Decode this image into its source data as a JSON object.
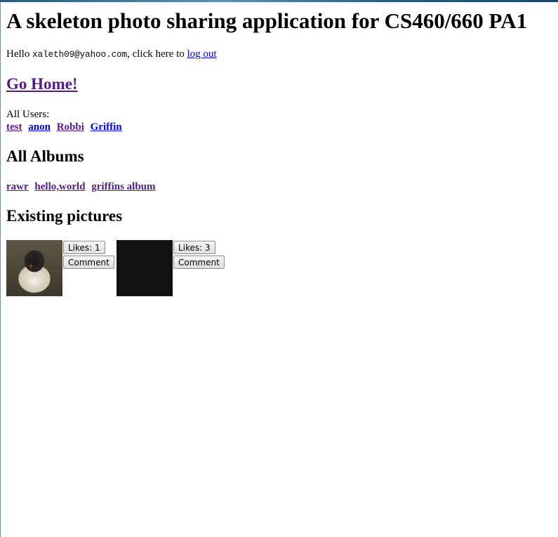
{
  "header": {
    "title": "A skeleton photo sharing application for CS460/660 PA1"
  },
  "greeting": {
    "prefix": "Hello ",
    "email": "xaleth09@yahoo.com",
    "middle": ", click here to ",
    "logout_label": "log out"
  },
  "nav": {
    "home_label": "Go Home!"
  },
  "users": {
    "label": "All Users:",
    "items": [
      "test",
      "anon",
      "Robbi",
      "Griffin"
    ]
  },
  "albums": {
    "heading": "All Albums",
    "items": [
      "rawr",
      "hello,world",
      "griffins album"
    ]
  },
  "pictures": {
    "heading": "Existing pictures",
    "items": [
      {
        "likes_label": "Likes: 1",
        "comment_label": "Comment"
      },
      {
        "likes_label": "Likes: 3",
        "comment_label": "Comment"
      }
    ]
  }
}
